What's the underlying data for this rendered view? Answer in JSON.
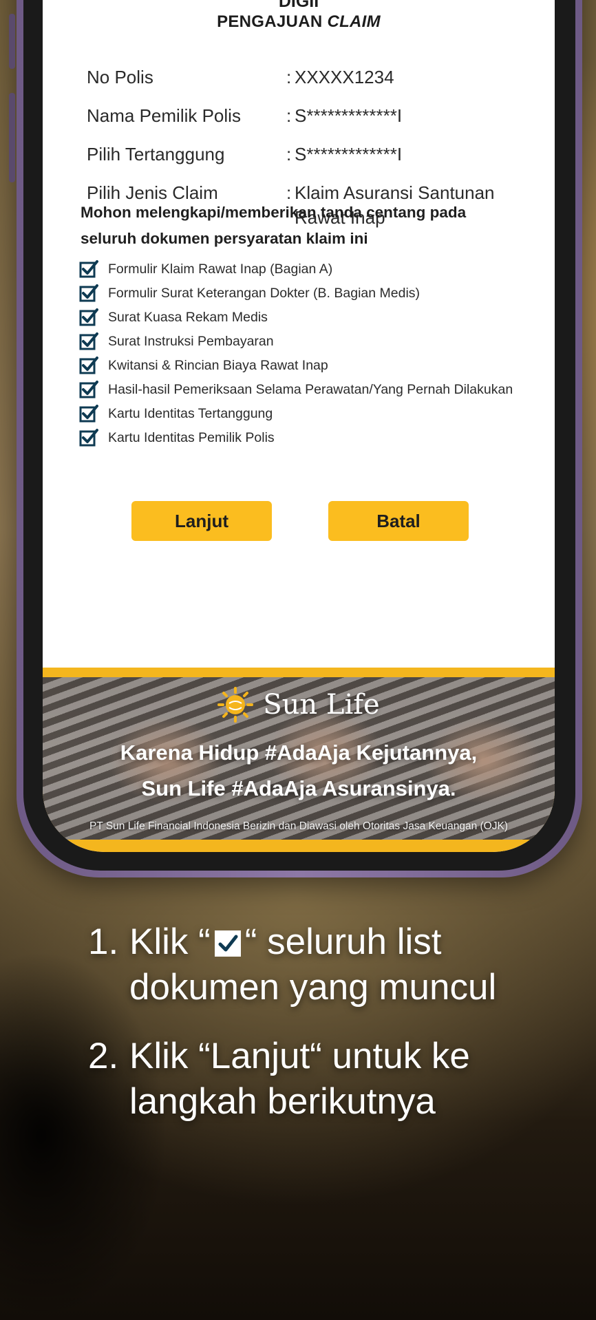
{
  "form": {
    "top_cut_text": "DIGII",
    "title_prefix": "PENGAJUAN",
    "title_italic": "CLAIM",
    "fields": [
      {
        "label": "No Polis",
        "value": "XXXXX1234"
      },
      {
        "label": "Nama Pemilik Polis",
        "value": "S*************I"
      },
      {
        "label": "Pilih Tertanggung",
        "value": "S*************I"
      },
      {
        "label": "Pilih Jenis Claim",
        "value": "Klaim Asuransi Santunan Rawat Inap"
      }
    ],
    "colon": ":",
    "instruction": "Mohon melengkapi/memberikan tanda centang pada seluruh dokumen persyaratan klaim ini",
    "documents": [
      {
        "label": "Formulir Klaim Rawat Inap (Bagian A)",
        "checked": true
      },
      {
        "label": "Formulir Surat Keterangan Dokter (B. Bagian Medis)",
        "checked": true
      },
      {
        "label": "Surat Kuasa Rekam Medis",
        "checked": true
      },
      {
        "label": "Surat Instruksi Pembayaran",
        "checked": true
      },
      {
        "label": "Kwitansi & Rincian Biaya Rawat Inap",
        "checked": true
      },
      {
        "label": "Hasil-hasil Pemeriksaan Selama Perawatan/Yang Pernah Dilakukan",
        "checked": true
      },
      {
        "label": "Kartu Identitas Tertanggung",
        "checked": true
      },
      {
        "label": "Kartu Identitas Pemilik Polis",
        "checked": true
      }
    ],
    "next_button": "Lanjut",
    "cancel_button": "Batal"
  },
  "banner": {
    "brand": "Sun Life",
    "tagline_1": "Karena Hidup #AdaAja Kejutannya,",
    "tagline_2": "Sun Life #AdaAja Asuransinya.",
    "disclaimer": "PT Sun Life Financial Indonesia Berizin dan Diawasi oleh Otoritas Jasa Keuangan (OJK)",
    "logo_icon": "sun-life-logo-icon"
  },
  "steps": [
    {
      "number": "1.",
      "before": "Klik  “",
      "after": "“  seluruh list dokumen yang muncul",
      "icon": "checkbox-checked-icon"
    },
    {
      "number": "2.",
      "text": "Klik “Lanjut“ untuk ke langkah berikutnya"
    }
  ],
  "colors": {
    "accent": "#fbbd1f",
    "check": "#0e3a52",
    "phone_frame": "#7e6a98"
  }
}
